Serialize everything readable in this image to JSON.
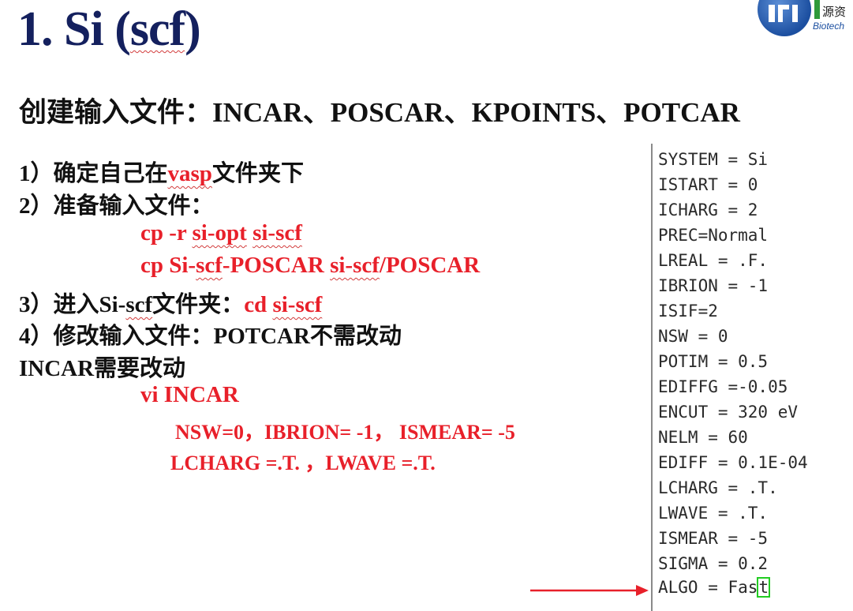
{
  "title": {
    "prefix": "1. Si (",
    "squiggled": "scf",
    "suffix": ")"
  },
  "logo": {
    "cn_text": "源资",
    "en_text": "Biotech"
  },
  "subtitle": "创建输入文件：INCAR、POSCAR、KPOINTS、POTCAR",
  "steps": {
    "s1_prefix": "1）确定自己在",
    "s1_keyword": "vasp",
    "s1_suffix": "文件夹下",
    "s2": "2）准备输入文件：",
    "cmd1_a": "cp  -r  ",
    "cmd1_b": "si-opt",
    "cmd1_c": "  ",
    "cmd1_d": "si-scf",
    "cmd2_a": "cp  Si-",
    "cmd2_b": "scf",
    "cmd2_c": "-POSCAR ",
    "cmd2_d": "si-scf",
    "cmd2_e": "/POSCAR",
    "s3_a": "3）进入Si-",
    "s3_b": "scf",
    "s3_c": "文件夹：",
    "s3_cmd_a": "cd  ",
    "s3_cmd_b": "si-scf",
    "s4": "4）修改输入文件：POTCAR不需改动",
    "incar_note": "INCAR需要改动",
    "vi_cmd": "vi  INCAR",
    "param1": "NSW=0，IBRION= -1， ISMEAR= -5",
    "param2": "LCHARG =.T. ，LWAVE =.T."
  },
  "incar": {
    "lines": [
      "SYSTEM = Si",
      "ISTART = 0",
      "ICHARG = 2",
      "PREC=Normal",
      "LREAL = .F.",
      "IBRION = -1",
      "ISIF=2",
      "NSW = 0",
      "POTIM = 0.5",
      "EDIFFG =-0.05",
      "ENCUT = 320 eV",
      "NELM = 60",
      "EDIFF = 0.1E-04",
      "LCHARG = .T.",
      "LWAVE = .T.",
      "ISMEAR = -5",
      "SIGMA = 0.2"
    ],
    "last_line_prefix": "ALGO = Fas",
    "last_line_cursor": "t"
  },
  "colors": {
    "title": "#14205e",
    "highlight": "#e8202a",
    "cursor": "#22cc22",
    "arrow": "#e8202a"
  }
}
